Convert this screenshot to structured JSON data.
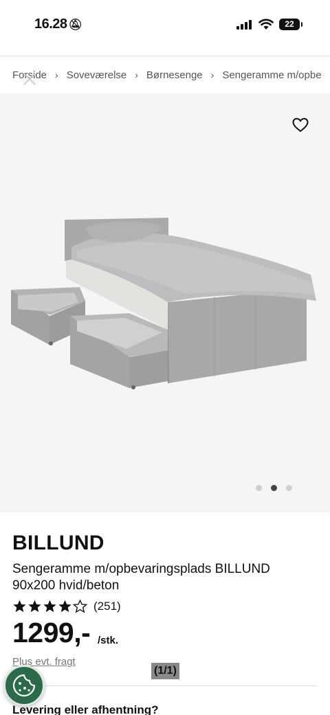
{
  "status_bar": {
    "time": "16.28",
    "battery": "22"
  },
  "breadcrumb": {
    "items": [
      "Forside",
      "Soveværelse",
      "Børnesenge",
      "Sengeramme m/opbe"
    ],
    "separator": "›"
  },
  "product_image": {
    "carousel_count": 3,
    "carousel_active_index": 1
  },
  "product": {
    "brand": "BILLUND",
    "description": "Sengeramme m/opbevaringsplads BILLUND 90x200 hvid/beton",
    "rating": 4.5,
    "rating_count": "(251)",
    "price": "1299,-",
    "price_unit": "/stk.",
    "freight_link": "Plus evt. fragt",
    "page_indicator": "(1/1)"
  },
  "delivery": {
    "heading": "Levering eller afhentning?"
  },
  "icons": {
    "close": "close-icon",
    "favorite": "heart-icon",
    "cookie": "cookie-icon"
  },
  "colors": {
    "image_bg": "#f5f5f5",
    "cookie_button": "#2b6b4b",
    "dot_active": "#444444",
    "dot_inactive": "#cfcfcf"
  }
}
